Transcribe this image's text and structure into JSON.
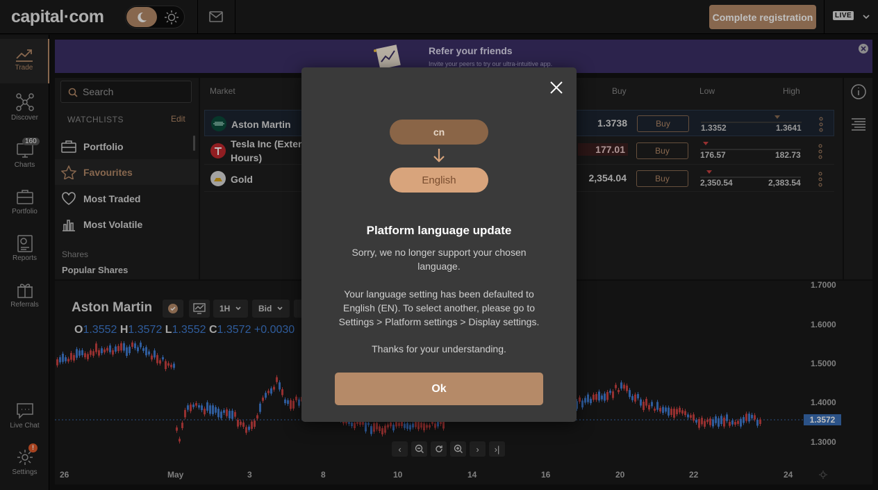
{
  "header": {
    "logo": "capital·com",
    "register_label": "Complete registration",
    "account_mode": "LIVE"
  },
  "nav": [
    {
      "label": "Trade",
      "icon": "trend-icon"
    },
    {
      "label": "Discover",
      "icon": "network-icon"
    },
    {
      "label": "Charts",
      "icon": "monitor-icon",
      "badge": "160"
    },
    {
      "label": "Portfolio",
      "icon": "briefcase-icon"
    },
    {
      "label": "Reports",
      "icon": "report-icon"
    },
    {
      "label": "Referrals",
      "icon": "gift-icon"
    },
    {
      "label": "Live Chat",
      "icon": "chat-icon"
    },
    {
      "label": "Settings",
      "icon": "gear-icon",
      "badge": "!"
    }
  ],
  "banner": {
    "title": "Refer your friends",
    "subtitle": "Invite your peers to try our ultra-intuitive app."
  },
  "search": {
    "placeholder": "Search"
  },
  "watchlists": {
    "heading": "WATCHLISTS",
    "edit_label": "Edit",
    "items": [
      "Portfolio",
      "Favourites",
      "Most Traded",
      "Most Volatile"
    ],
    "section_label": "Shares",
    "section_item": "Popular Shares"
  },
  "market": {
    "headers": {
      "market": "Market",
      "buy": "Buy",
      "low": "Low",
      "high": "High"
    },
    "buy_label": "Buy",
    "rows": [
      {
        "name": "Aston Martin",
        "price": "1.3738",
        "low": "1.3352",
        "high": "1.3641"
      },
      {
        "name": "Tesla Inc (Extended Hours)",
        "name_line1": "Tesla Inc (Extend",
        "name_line2": "Hours)",
        "price": "177.01",
        "low": "176.57",
        "high": "182.73"
      },
      {
        "name": "Gold",
        "price": "2,354.04",
        "low": "2,350.54",
        "high": "2,383.54"
      }
    ]
  },
  "chart": {
    "instrument": "Aston Martin",
    "timeframe": "1H",
    "price_type": "Bid",
    "ohlc": {
      "o_label": "O",
      "o": "1.3552",
      "h_label": "H",
      "h": "1.3572",
      "l_label": "L",
      "l": "1.3552",
      "c_label": "C",
      "c": "1.3572",
      "change": "+0.0030"
    },
    "y_ticks": [
      "1.7000",
      "1.6000",
      "1.5000",
      "1.4000",
      "1.3000"
    ],
    "x_ticks": [
      "26",
      "May",
      "3",
      "8",
      "10",
      "14",
      "16",
      "20",
      "22",
      "24"
    ],
    "current_price": "1.3572"
  },
  "modal": {
    "from_lang": "cn",
    "to_lang": "English",
    "title": "Platform language update",
    "p1": "Sorry, we no longer support your chosen language.",
    "p2": "Your language setting has been defaulted to English (EN). To select another, please go to Settings > Platform settings > Display settings.",
    "p3": "Thanks for your understanding.",
    "ok_label": "Ok"
  },
  "colors": {
    "accent": "#b58a68",
    "up": "#3f7bd0",
    "down": "#c94040",
    "banner": "#3b2f66"
  }
}
